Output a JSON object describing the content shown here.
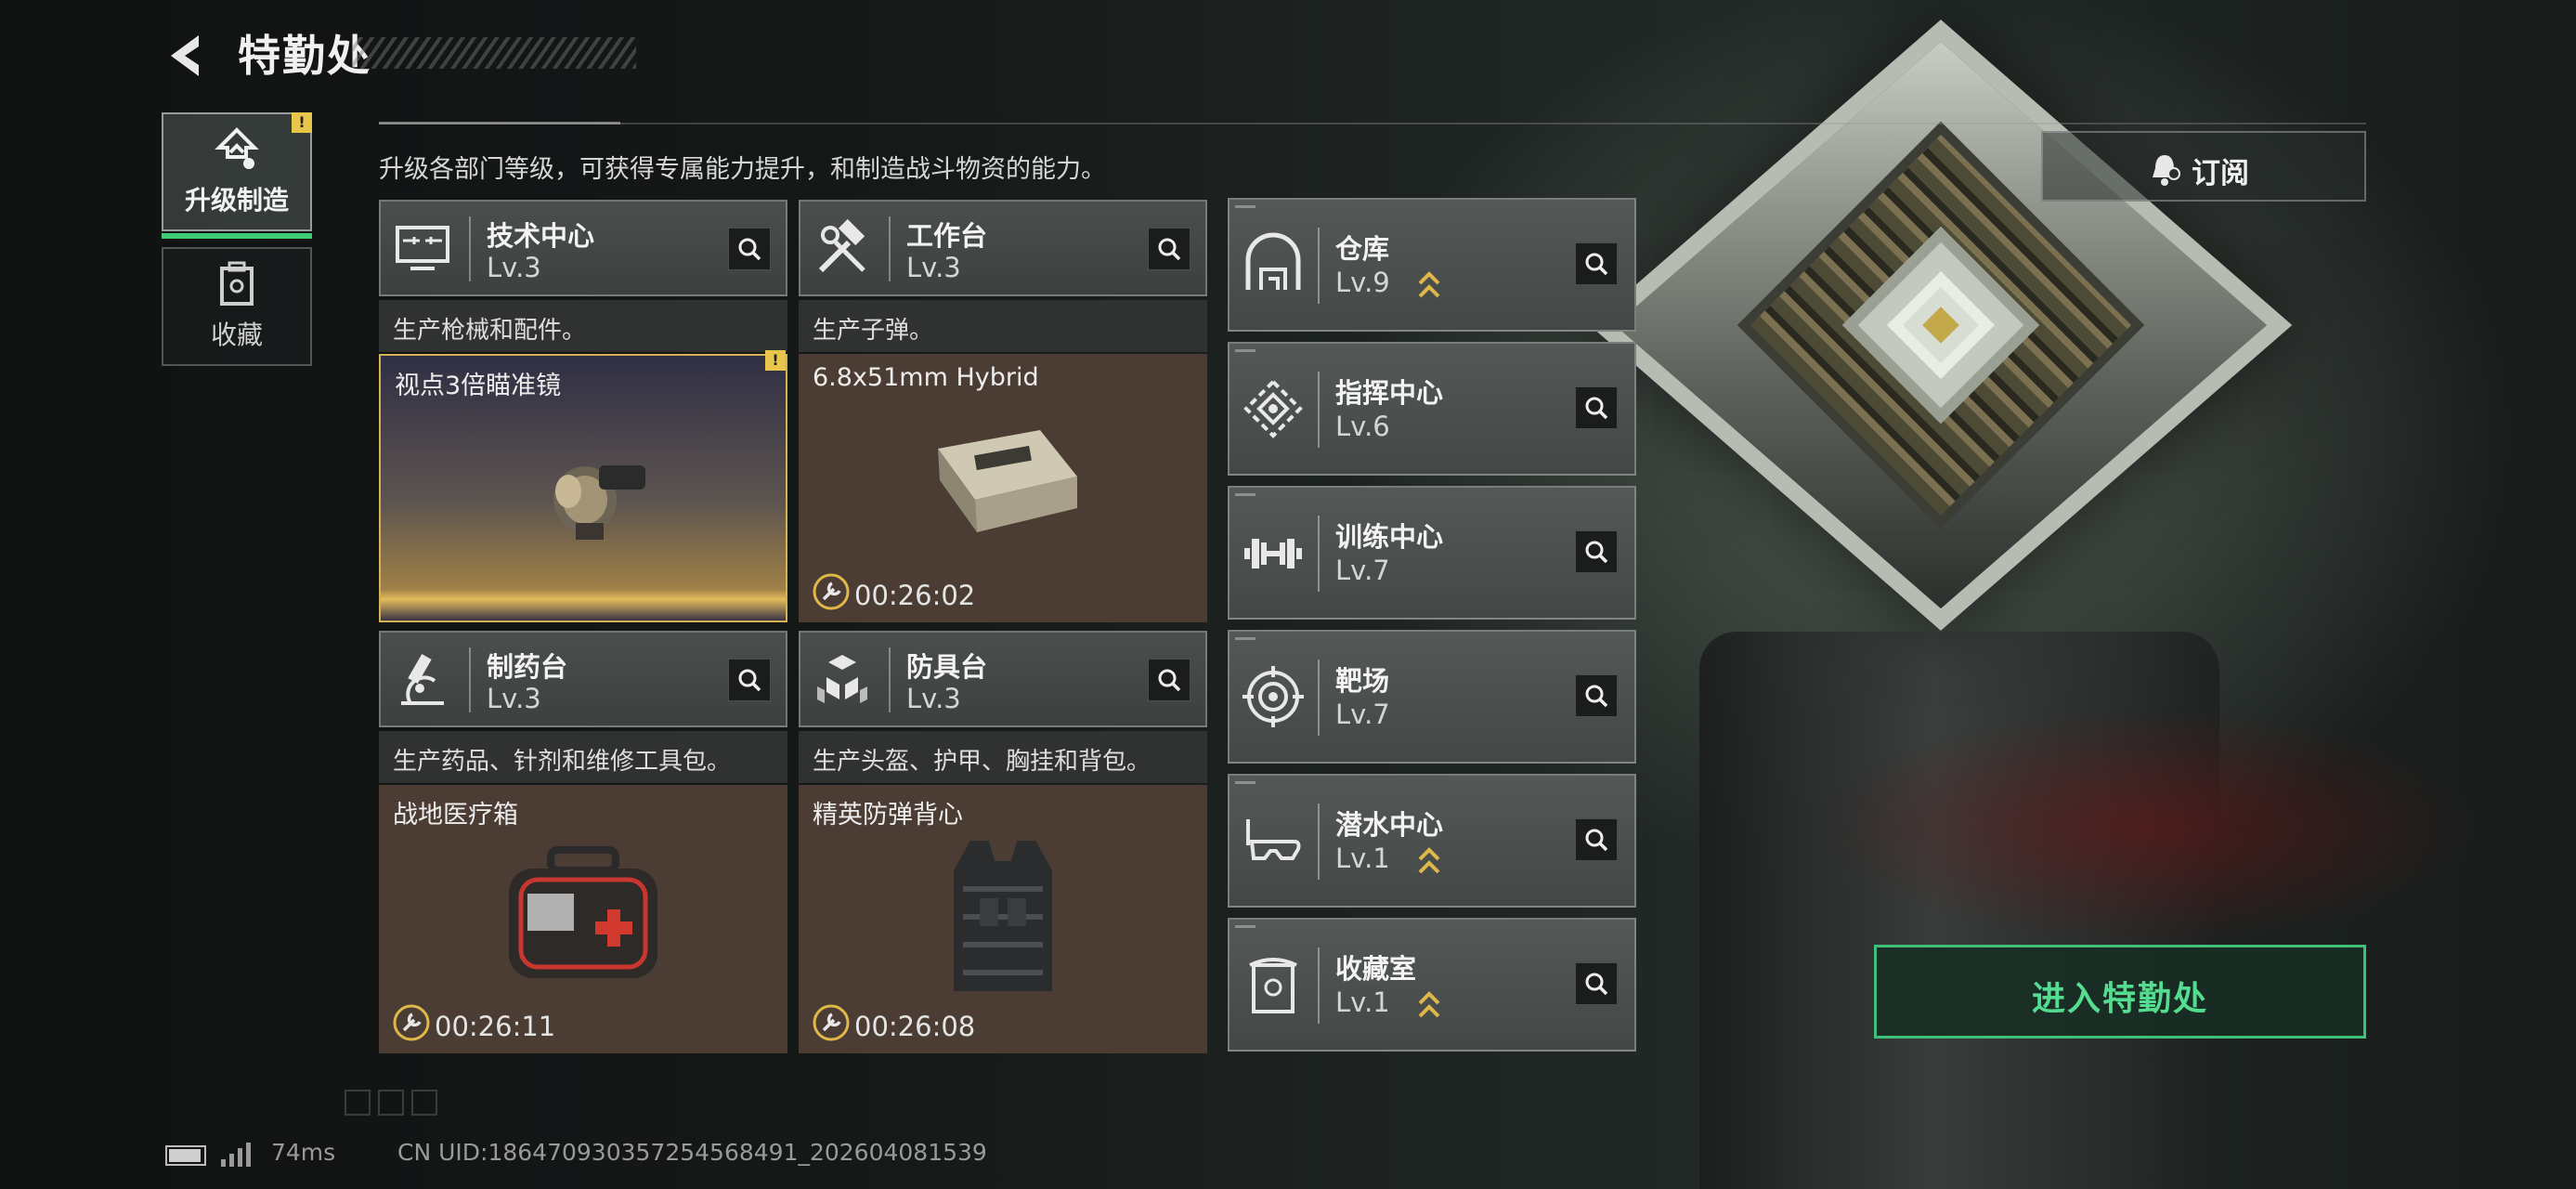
{
  "header": {
    "title": "特勤处",
    "description": "升级各部门等级，可获得专属能力提升，和制造战斗物资的能力。"
  },
  "nav": {
    "tabs": [
      {
        "label": "升级制造",
        "icon": "upgrade-arrow-icon",
        "active": true,
        "badge": "!"
      },
      {
        "label": "收藏",
        "icon": "collection-case-icon",
        "active": false
      }
    ]
  },
  "production": [
    {
      "name": "技术中心",
      "level": "Lv.3",
      "icon": "monitor-icon",
      "subtitle": "生产枪械和配件。",
      "item": "视点3倍瞄准镜",
      "item_icon": "scope-icon",
      "timer": "",
      "badge": "!"
    },
    {
      "name": "工作台",
      "level": "Lv.3",
      "icon": "hammer-wrench-icon",
      "subtitle": "生产子弹。",
      "item": "6.8x51mm Hybrid",
      "item_icon": "ammo-box-icon",
      "timer": "00:26:02"
    },
    {
      "name": "制药台",
      "level": "Lv.3",
      "icon": "microscope-icon",
      "subtitle": "生产药品、针剂和维修工具包。",
      "item": "战地医疗箱",
      "item_icon": "medkit-icon",
      "timer": "00:26:11"
    },
    {
      "name": "防具台",
      "level": "Lv.3",
      "icon": "cubes-icon",
      "subtitle": "生产头盔、护甲、胸挂和背包。",
      "item": "精英防弹背心",
      "item_icon": "vest-icon",
      "timer": "00:26:08"
    }
  ],
  "facilities": [
    {
      "name": "仓库",
      "level": "Lv.9",
      "icon": "warehouse-icon",
      "upgrade": true
    },
    {
      "name": "指挥中心",
      "level": "Lv.6",
      "icon": "command-center-icon",
      "upgrade": false
    },
    {
      "name": "训练中心",
      "level": "Lv.7",
      "icon": "dumbbell-icon",
      "upgrade": false
    },
    {
      "name": "靶场",
      "level": "Lv.7",
      "icon": "target-icon",
      "upgrade": false
    },
    {
      "name": "潜水中心",
      "level": "Lv.1",
      "icon": "diving-mask-icon",
      "upgrade": true
    },
    {
      "name": "收藏室",
      "level": "Lv.1",
      "icon": "collection-room-icon",
      "upgrade": true
    }
  ],
  "buttons": {
    "subscribe": "订阅",
    "enter": "进入特勤处"
  },
  "status": {
    "ping": "74ms",
    "uid": "CN UID:1864709303572545684​91_202604081539"
  },
  "colors": {
    "accent_green": "#3fc07a",
    "badge_yellow": "#e8c64b",
    "upgrade_gold": "#e0b84a"
  }
}
